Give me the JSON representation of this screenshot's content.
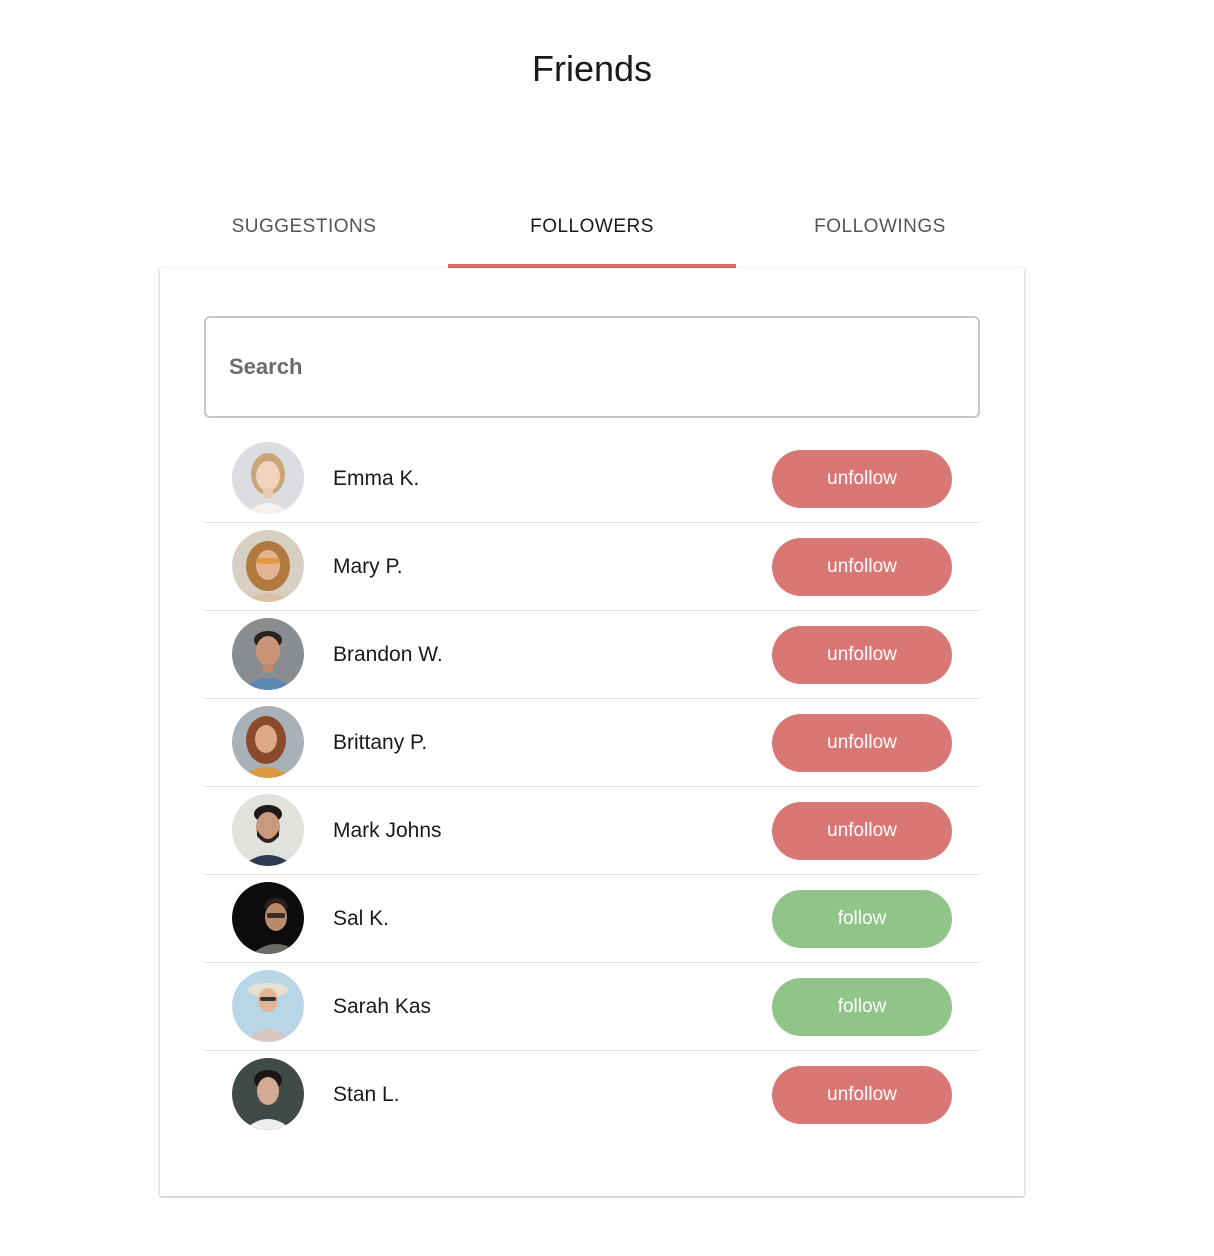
{
  "page": {
    "title": "Friends"
  },
  "tabs": [
    {
      "label": "SUGGESTIONS",
      "active": false
    },
    {
      "label": "FOLLOWERS",
      "active": true
    },
    {
      "label": "FOLLOWINGS",
      "active": false
    }
  ],
  "search": {
    "placeholder": "Search",
    "value": ""
  },
  "colors": {
    "accent": "#e06b66",
    "unfollow": "#d97775",
    "follow": "#91c489"
  },
  "users": [
    {
      "name": "Emma K.",
      "action": "unfollow",
      "avatar": "avatar-emma-icon"
    },
    {
      "name": "Mary P.",
      "action": "unfollow",
      "avatar": "avatar-mary-icon"
    },
    {
      "name": "Brandon W.",
      "action": "unfollow",
      "avatar": "avatar-brandon-icon"
    },
    {
      "name": "Brittany P.",
      "action": "unfollow",
      "avatar": "avatar-brittany-icon"
    },
    {
      "name": "Mark Johns",
      "action": "unfollow",
      "avatar": "avatar-mark-icon"
    },
    {
      "name": "Sal K.",
      "action": "follow",
      "avatar": "avatar-sal-icon"
    },
    {
      "name": "Sarah Kas",
      "action": "follow",
      "avatar": "avatar-sarah-icon"
    },
    {
      "name": "Stan L.",
      "action": "unfollow",
      "avatar": "avatar-stan-icon"
    }
  ]
}
